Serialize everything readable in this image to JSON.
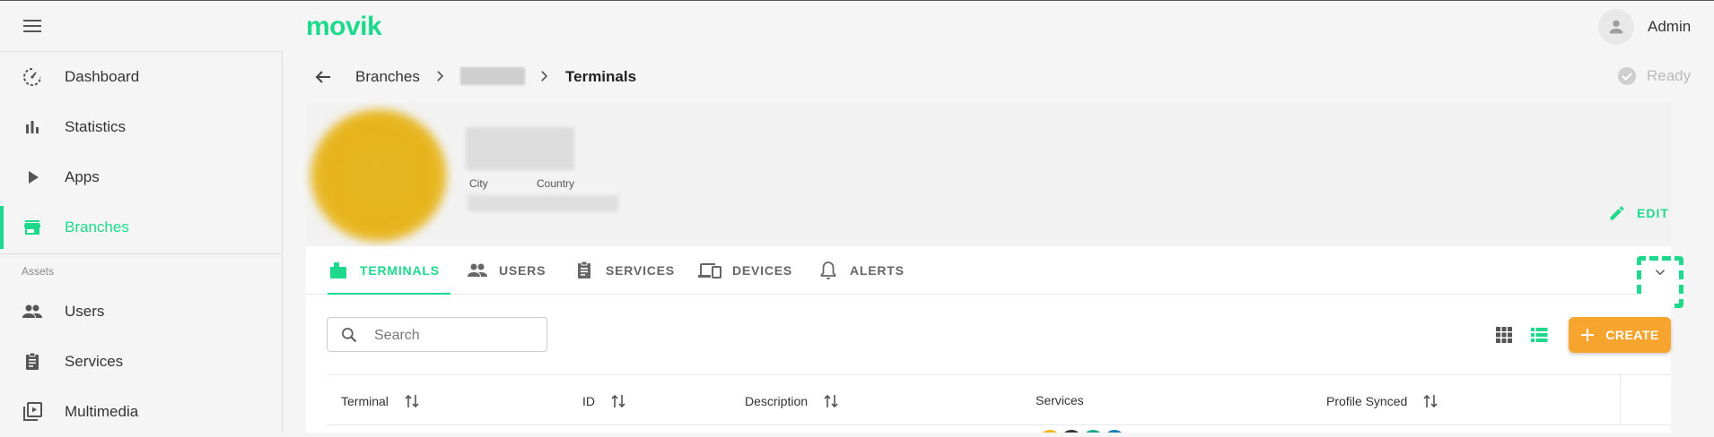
{
  "app": {
    "logo": "movik",
    "user_name": "Admin",
    "brand_color": "#1ed98c",
    "accent_color": "#f7a52e"
  },
  "sidebar": {
    "items": [
      {
        "label": "Dashboard",
        "icon": "dashboard-icon"
      },
      {
        "label": "Statistics",
        "icon": "bar-chart-icon"
      },
      {
        "label": "Apps",
        "icon": "play-icon"
      },
      {
        "label": "Branches",
        "icon": "store-icon",
        "active": true
      }
    ],
    "section_label": "Assets",
    "asset_items": [
      {
        "label": "Users",
        "icon": "people-icon"
      },
      {
        "label": "Services",
        "icon": "clipboard-icon"
      },
      {
        "label": "Multimedia",
        "icon": "video-library-icon"
      }
    ]
  },
  "breadcrumb": {
    "items": [
      "Branches",
      "Terminals"
    ]
  },
  "status": {
    "label": "Ready"
  },
  "branch": {
    "city_label": "City",
    "country_label": "Country",
    "edit_label": "EDIT"
  },
  "tabs": [
    {
      "label": "TERMINALS",
      "icon": "terminal-icon",
      "active": true
    },
    {
      "label": "USERS",
      "icon": "people-icon"
    },
    {
      "label": "SERVICES",
      "icon": "clipboard-icon"
    },
    {
      "label": "DEVICES",
      "icon": "devices-icon"
    },
    {
      "label": "ALERTS",
      "icon": "bell-icon"
    }
  ],
  "toolbar": {
    "search_placeholder": "Search",
    "search_value": "",
    "create_label": "CREATE"
  },
  "table": {
    "columns": [
      {
        "label": "Terminal",
        "sortable": true
      },
      {
        "label": "ID",
        "sortable": true
      },
      {
        "label": "Description",
        "sortable": true
      },
      {
        "label": "Services",
        "sortable": false
      },
      {
        "label": "Profile Synced",
        "sortable": true
      }
    ]
  }
}
